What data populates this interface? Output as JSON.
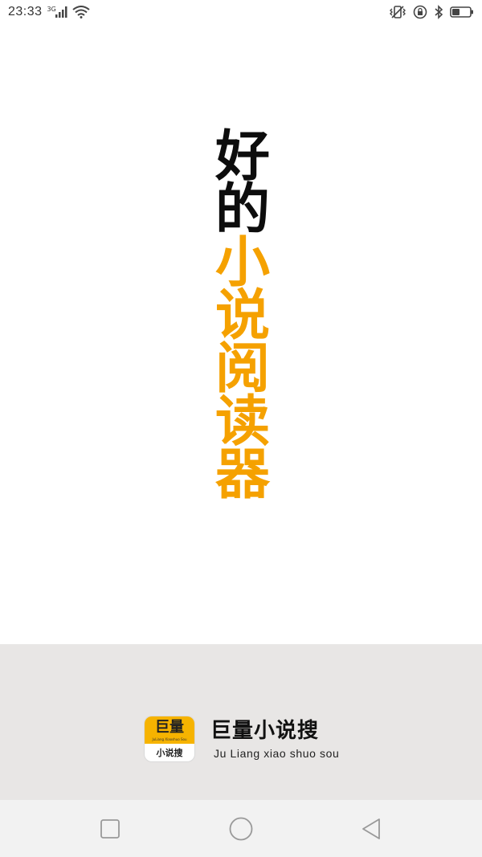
{
  "status_bar": {
    "time": "23:33",
    "network_type": "3G",
    "icons": [
      "signal-icon",
      "wifi-icon",
      "vibrate-icon",
      "rotation-lock-icon",
      "bluetooth-icon",
      "battery-icon"
    ]
  },
  "splash": {
    "characters": [
      {
        "char": "好",
        "tone": "dark"
      },
      {
        "char": "的",
        "tone": "dark"
      },
      {
        "char": "小",
        "tone": "accent"
      },
      {
        "char": "说",
        "tone": "accent"
      },
      {
        "char": "阅",
        "tone": "accent"
      },
      {
        "char": "读",
        "tone": "accent"
      },
      {
        "char": "器",
        "tone": "accent"
      }
    ],
    "colors": {
      "dark": "#0d0d0d",
      "accent": "#f5a100"
    }
  },
  "brand": {
    "logo_top": "巨量",
    "logo_fine_print": "JuLiang Xiaoshuo Sou",
    "logo_bottom": "小说搜",
    "name": "巨量小说搜",
    "pinyin": "Ju Liang xiao shuo sou",
    "band_color": "#e8e6e5",
    "logo_color": "#f6b300"
  },
  "nav_bar": {
    "buttons": [
      "recent-apps-icon",
      "home-icon",
      "back-icon"
    ]
  }
}
